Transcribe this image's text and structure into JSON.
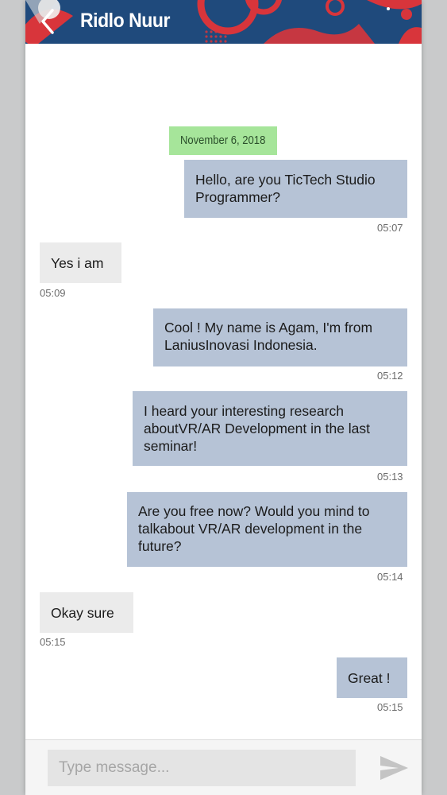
{
  "header": {
    "title": "Ridlo Nuur",
    "back_icon": "chevron-left-icon",
    "menu_icon": "overflow-menu-icon",
    "background_color": "#1f4a7c",
    "accent_color": "#d8353b"
  },
  "chat": {
    "date_separator": "November 6, 2018",
    "messages": [
      {
        "direction": "outgoing",
        "lines": [
          "Hello, are you TicTech Studio",
          "Programmer?"
        ],
        "time": "05:07"
      },
      {
        "direction": "incoming",
        "lines": [
          "Yes i am"
        ],
        "time": "05:09"
      },
      {
        "direction": "outgoing",
        "lines": [
          "Cool ! My name is Agam, I'm from",
          "LaniusInovasi Indonesia."
        ],
        "time": "05:12"
      },
      {
        "direction": "outgoing",
        "lines": [
          "I heard your interesting research",
          "aboutVR/AR Development in the last",
          "seminar!"
        ],
        "time": "05:13"
      },
      {
        "direction": "outgoing",
        "lines": [
          "Are you free now? Would you mind to",
          "talkabout VR/AR development in the",
          "future?"
        ],
        "time": "05:14"
      },
      {
        "direction": "incoming",
        "lines": [
          "Okay sure"
        ],
        "time": "05:15"
      },
      {
        "direction": "outgoing",
        "lines": [
          "Great !"
        ],
        "time": "05:15"
      }
    ],
    "outgoing_bubble_color": "#b6c3d6",
    "incoming_bubble_color": "#ebebeb",
    "date_chip_color": "#a6e59a"
  },
  "composer": {
    "placeholder": "Type message...",
    "value": "",
    "send_icon": "send-icon"
  }
}
